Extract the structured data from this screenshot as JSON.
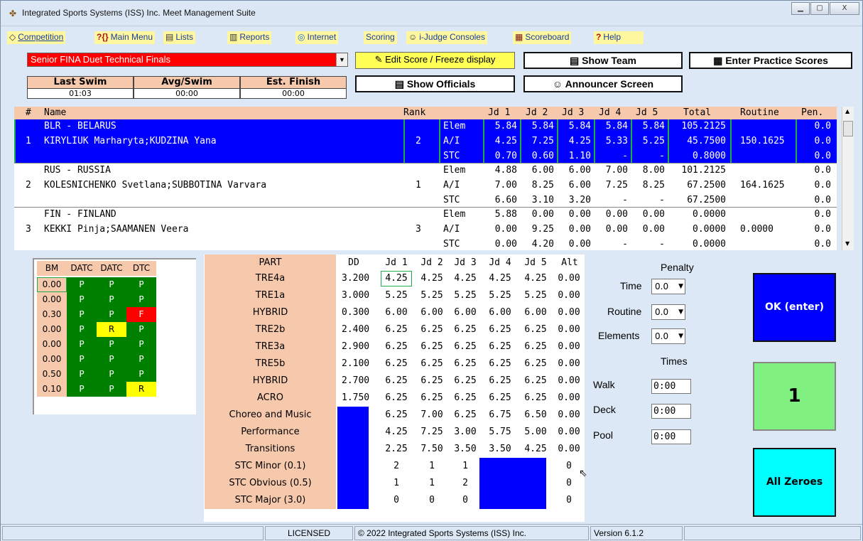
{
  "window": {
    "title": "Integrated Sports Systems (ISS) Inc. Meet Management Suite",
    "min": "▁",
    "max": "▢",
    "close": "X"
  },
  "menu": [
    {
      "label": "Competition",
      "icon": "◇"
    },
    {
      "label": "Main Menu",
      "icon": "?{}"
    },
    {
      "label": "Lists",
      "icon": "▤"
    },
    {
      "label": "Reports",
      "icon": "▥"
    },
    {
      "label": "Internet",
      "icon": "◎"
    },
    {
      "label": "Scoring",
      "icon": ""
    },
    {
      "label": "i-Judge Consoles",
      "icon": "☺"
    },
    {
      "label": "Scoreboard",
      "icon": "▦"
    },
    {
      "label": "Help",
      "icon": "?"
    }
  ],
  "event": {
    "selected": "Senior FINA Duet Technical Finals"
  },
  "buttons": {
    "edit_score": "Edit Score / Freeze display",
    "show_team": "Show Team",
    "enter_practice": "Enter Practice Scores",
    "show_officials": "Show Officials",
    "announcer": "Announcer Screen"
  },
  "stats": {
    "last_swim_label": "Last Swim",
    "last_swim": "01:03",
    "avg_label": "Avg/Swim",
    "avg": "00:00",
    "est_label": "Est. Finish",
    "est": "00:00"
  },
  "grid": {
    "headers": [
      "#",
      "Name",
      "Rank",
      "Jd 1",
      "Jd 2",
      "Jd 3",
      "Jd 4",
      "Jd 5",
      "Total",
      "Routine",
      "Pen."
    ],
    "rows": [
      {
        "num": "1",
        "team": "BLR - BELARUS",
        "names": "KIRYLIUK Marharyta;KUDZINA Yana",
        "rank": "2",
        "routine": "150.1625",
        "lines": [
          {
            "cat": "Elem",
            "j": [
              "5.84",
              "5.84",
              "5.84",
              "5.84",
              "5.84"
            ],
            "total": "105.2125",
            "pen": "0.0"
          },
          {
            "cat": "A/I",
            "j": [
              "4.25",
              "7.25",
              "4.25",
              "5.33",
              "5.25"
            ],
            "total": "45.7500",
            "pen": "0.0"
          },
          {
            "cat": "STC",
            "j": [
              "0.70",
              "0.60",
              "1.10",
              "-",
              "-"
            ],
            "total": "0.8000",
            "pen": "0.0"
          }
        ]
      },
      {
        "num": "2",
        "team": "RUS - RUSSIA",
        "names": "KOLESNICHENKO Svetlana;SUBBOTINA Varvara",
        "rank": "1",
        "routine": "164.1625",
        "lines": [
          {
            "cat": "Elem",
            "j": [
              "4.88",
              "6.00",
              "6.00",
              "7.00",
              "8.00"
            ],
            "total": "101.2125",
            "pen": "0.0"
          },
          {
            "cat": "A/I",
            "j": [
              "7.00",
              "8.25",
              "6.00",
              "7.25",
              "8.25"
            ],
            "total": "67.2500",
            "pen": "0.0"
          },
          {
            "cat": "STC",
            "j": [
              "6.60",
              "3.10",
              "3.20",
              "-",
              "-"
            ],
            "total": "67.2500",
            "pen": "0.0"
          }
        ]
      },
      {
        "num": "3",
        "team": "FIN - FINLAND",
        "names": "KEKKI Pinja;SAAMANEN Veera",
        "rank": "3",
        "routine": "0.0000",
        "lines": [
          {
            "cat": "Elem",
            "j": [
              "5.88",
              "0.00",
              "0.00",
              "0.00",
              "0.00"
            ],
            "total": "0.0000",
            "pen": "0.0"
          },
          {
            "cat": "A/I",
            "j": [
              "0.00",
              "9.25",
              "0.00",
              "0.00",
              "0.00"
            ],
            "total": "0.0000",
            "pen": "0.0"
          },
          {
            "cat": "STC",
            "j": [
              "0.00",
              "4.20",
              "0.00",
              "-",
              "-"
            ],
            "total": "0.0000",
            "pen": "0.0"
          }
        ]
      }
    ]
  },
  "fail_panel": {
    "headers": [
      "BM",
      "DATC",
      "DATC",
      "DTC"
    ],
    "rows": [
      [
        "0.00",
        "P",
        "P",
        "P"
      ],
      [
        "0.00",
        "P",
        "P",
        "P"
      ],
      [
        "0.30",
        "P",
        "P",
        "F"
      ],
      [
        "0.00",
        "P",
        "R",
        "P"
      ],
      [
        "0.00",
        "P",
        "P",
        "P"
      ],
      [
        "0.00",
        "P",
        "P",
        "P"
      ],
      [
        "0.50",
        "P",
        "P",
        "P"
      ],
      [
        "0.10",
        "P",
        "P",
        "R"
      ]
    ]
  },
  "scores": {
    "headers": [
      "PART",
      "DD",
      "Jd 1",
      "Jd 2",
      "Jd 3",
      "Jd 4",
      "Jd 5",
      "Alt"
    ],
    "elements": [
      {
        "part": "TRE4a",
        "dd": "3.200",
        "j": [
          "4.25",
          "4.25",
          "4.25",
          "4.25",
          "4.25"
        ],
        "alt": "0.00"
      },
      {
        "part": "TRE1a",
        "dd": "3.000",
        "j": [
          "5.25",
          "5.25",
          "5.25",
          "5.25",
          "5.25"
        ],
        "alt": "0.00"
      },
      {
        "part": "HYBRID",
        "dd": "0.300",
        "j": [
          "6.00",
          "6.00",
          "6.00",
          "6.00",
          "6.00"
        ],
        "alt": "0.00"
      },
      {
        "part": "TRE2b",
        "dd": "2.400",
        "j": [
          "6.25",
          "6.25",
          "6.25",
          "6.25",
          "6.25"
        ],
        "alt": "0.00"
      },
      {
        "part": "TRE3a",
        "dd": "2.900",
        "j": [
          "6.25",
          "6.25",
          "6.25",
          "6.25",
          "6.25"
        ],
        "alt": "0.00"
      },
      {
        "part": "TRE5b",
        "dd": "2.100",
        "j": [
          "6.25",
          "6.25",
          "6.25",
          "6.25",
          "6.25"
        ],
        "alt": "0.00"
      },
      {
        "part": "HYBRID",
        "dd": "2.700",
        "j": [
          "6.25",
          "6.25",
          "6.25",
          "6.25",
          "6.25"
        ],
        "alt": "0.00"
      },
      {
        "part": "ACRO",
        "dd": "1.750",
        "j": [
          "6.25",
          "6.25",
          "6.25",
          "6.25",
          "6.25"
        ],
        "alt": "0.00"
      }
    ],
    "impression": [
      {
        "part": "Choreo and Music",
        "j": [
          "6.25",
          "7.00",
          "6.25",
          "6.75",
          "6.50"
        ],
        "alt": "0.00"
      },
      {
        "part": "Performance",
        "j": [
          "4.25",
          "7.25",
          "3.00",
          "5.75",
          "5.00"
        ],
        "alt": "0.00"
      },
      {
        "part": "Transitions",
        "j": [
          "2.25",
          "7.50",
          "3.50",
          "3.50",
          "4.25"
        ],
        "alt": "0.00"
      }
    ],
    "stc": [
      {
        "part": "STC Minor (0.1)",
        "j": [
          "2",
          "1",
          "1"
        ],
        "alt": "0"
      },
      {
        "part": "STC Obvious (0.5)",
        "j": [
          "1",
          "1",
          "2"
        ],
        "alt": "0"
      },
      {
        "part": "STC Major (3.0)",
        "j": [
          "0",
          "0",
          "0"
        ],
        "alt": "0"
      }
    ]
  },
  "penalty": {
    "title": "Penalty",
    "time_label": "Time",
    "time": "0.0",
    "routine_label": "Routine",
    "routine": "0.0",
    "elements_label": "Elements",
    "elements": "0.0"
  },
  "times": {
    "title": "Times",
    "walk_label": "Walk",
    "walk": "0:00",
    "deck_label": "Deck",
    "deck": "0:00",
    "pool_label": "Pool",
    "pool": "0:00"
  },
  "actions": {
    "ok": "OK (enter)",
    "swimmer_number": "1",
    "all_zeroes": "All Zeroes"
  },
  "status": {
    "licensed": "LICENSED",
    "copyright": "© 2022 Integrated Sports Systems (ISS) Inc.",
    "version": "Version 6.1.2"
  },
  "colors": {
    "selected_row": "#0000ff",
    "header": "#f6c9ad",
    "pass": "#008000",
    "fail": "#ff0000",
    "review": "#ffff00",
    "ok_button": "#0000ff",
    "number_tile": "#80f080",
    "zero_button": "#00ffff"
  }
}
